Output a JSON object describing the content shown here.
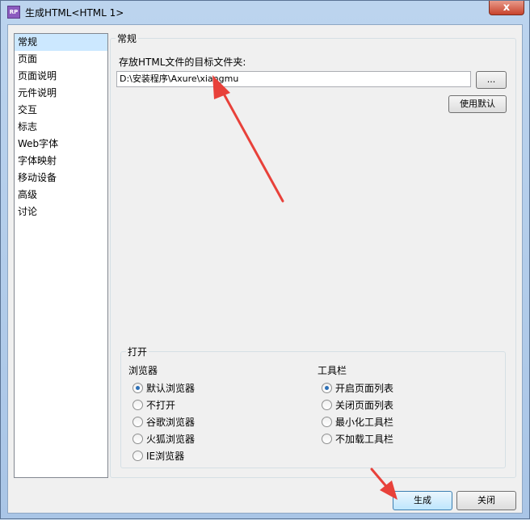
{
  "window": {
    "title": "生成HTML<HTML 1>",
    "close_glyph": "x",
    "app_icon": "RP"
  },
  "nav": {
    "items": [
      "常规",
      "页面",
      "页面说明",
      "元件说明",
      "交互",
      "标志",
      "Web字体",
      "字体映射",
      "移动设备",
      "高级",
      "讨论"
    ],
    "selected": 0
  },
  "general": {
    "title": "常规",
    "target_label": "存放HTML文件的目标文件夹:",
    "target_value": "D:\\安装程序\\Axure\\xiangmu",
    "browse_label": "...",
    "use_default_label": "使用默认"
  },
  "open": {
    "title": "打开",
    "browser": {
      "heading": "浏览器",
      "options": [
        "默认浏览器",
        "不打开",
        "谷歌浏览器",
        "火狐浏览器",
        "IE浏览器"
      ],
      "selected": 0
    },
    "toolbar": {
      "heading": "工具栏",
      "options": [
        "开启页面列表",
        "关闭页面列表",
        "最小化工具栏",
        "不加载工具栏"
      ],
      "selected": 0
    }
  },
  "footer": {
    "generate_label": "生成",
    "close_label": "关闭"
  },
  "colors": {
    "accent": "#3c7fb1",
    "annotation": "#e8413a",
    "selection": "#cce8ff"
  }
}
